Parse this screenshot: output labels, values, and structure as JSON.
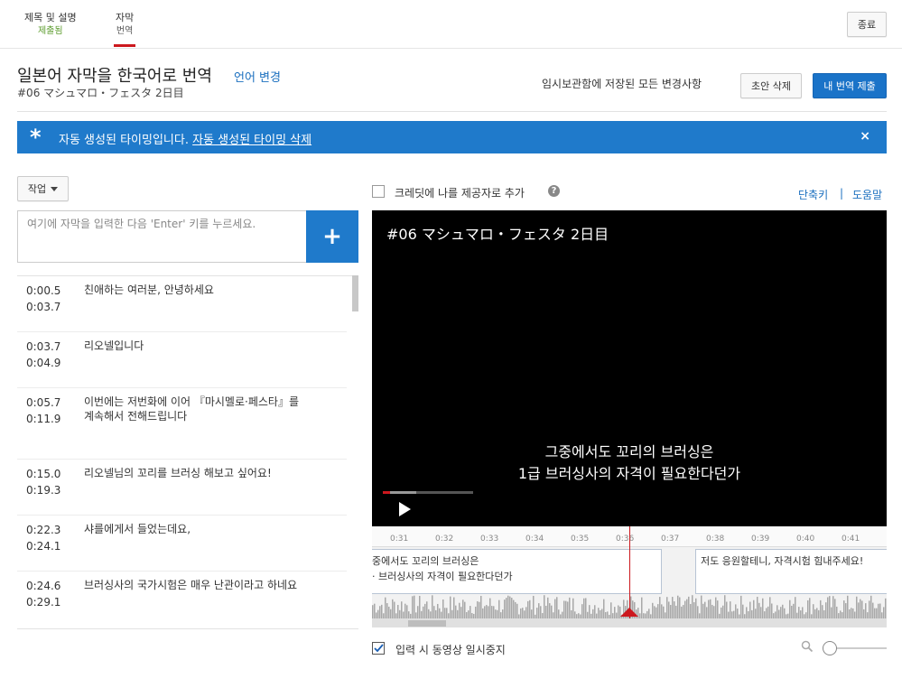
{
  "tabs": [
    {
      "label": "제목 및 설명",
      "status": "제출됨"
    },
    {
      "label": "자막",
      "status": "번역"
    }
  ],
  "close_button": "종료",
  "header": {
    "title": "일본어 자막을 한국어로 번역",
    "change_language": "언어 변경",
    "subtitle": "#06 マシュマロ・フェスタ 2日目",
    "saved_text": "임시보관함에 저장된 모든 변경사항",
    "discard_draft": "초안 삭제",
    "submit": "내 번역 제출"
  },
  "banner": {
    "message": "자동 생성된 타이밍입니다.",
    "link": "자동 생성된 타이밍 삭제",
    "close": "×",
    "color": "#1f7acb"
  },
  "editor": {
    "actions_label": "작업",
    "input_placeholder": "여기에 자막을 입력한 다음 'Enter' 키를 누르세요.",
    "add_label": "+",
    "captions": [
      {
        "start": "0:00.5",
        "end": "0:03.7",
        "text": "친애하는 여러분, 안녕하세요"
      },
      {
        "start": "0:03.7",
        "end": "0:04.9",
        "text": "리오넬입니다"
      },
      {
        "start": "0:05.7",
        "end": "0:11.9",
        "text": "이번에는 저번화에 이어 『마시멜로·페스타』를 계속해서 전해드립니다"
      },
      {
        "start": "0:15.0",
        "end": "0:19.3",
        "text": "리오넬님의 꼬리를 브러싱 해보고 싶어요!"
      },
      {
        "start": "0:22.3",
        "end": "0:24.1",
        "text": "샤를에게서 들었는데요,"
      },
      {
        "start": "0:24.6",
        "end": "0:29.1",
        "text": "브러싱사의 국가시험은 매우 난관이라고 하네요"
      }
    ]
  },
  "player": {
    "credit_label": "크레딧에 나를 제공자로 추가",
    "credit_checked": false,
    "shortcuts_link": "단축키",
    "separator": "|",
    "help_link": "도움말",
    "video_title": "#06 マシュマロ・フェスタ 2日目",
    "caption_line1": "그중에서도 꼬리의 브러싱은",
    "caption_line2": "1급 브러싱사의 자격이 필요한다던가",
    "progress_played": 0.08,
    "progress_buffered": 0.37
  },
  "timeline": {
    "ticks": [
      "0:31",
      "0:32",
      "0:33",
      "0:34",
      "0:35",
      "0:36",
      "0:37",
      "0:38",
      "0:39",
      "0:40",
      "0:41"
    ],
    "block1_line1": "중에서도 꼬리의 브러싱은",
    "block1_line2": "· 브러싱사의 자격이 필요한다던가",
    "block2_line1": "저도 응원할테니, 자격시험 힘내주세요!",
    "playhead_time": "0:36"
  },
  "pause_label": "입력 시 동영상 일시중지",
  "pause_checked": true
}
